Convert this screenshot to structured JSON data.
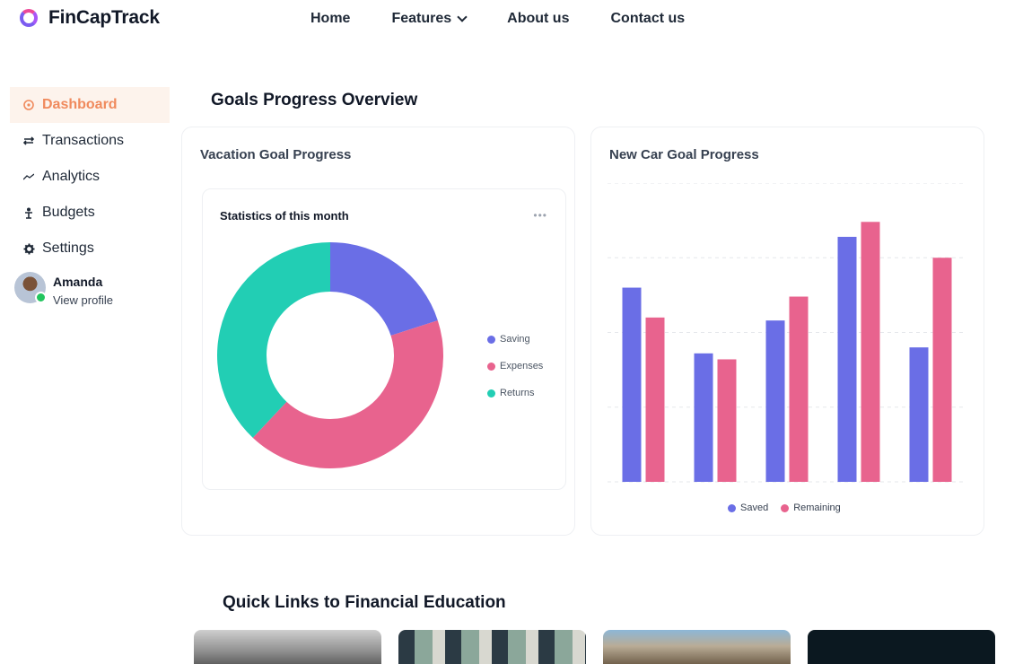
{
  "brand": {
    "name": "FinCapTrack"
  },
  "nav": {
    "items": [
      "Home",
      "Features",
      "About us",
      "Contact us"
    ]
  },
  "sidebar": {
    "items": [
      {
        "label": "Dashboard",
        "icon": "dashboard-icon"
      },
      {
        "label": "Transactions",
        "icon": "transactions-icon"
      },
      {
        "label": "Analytics",
        "icon": "analytics-icon"
      },
      {
        "label": "Budgets",
        "icon": "budgets-icon"
      },
      {
        "label": "Settings",
        "icon": "gear-icon"
      }
    ],
    "profile": {
      "name": "Amanda",
      "link": "View profile"
    }
  },
  "main": {
    "goals_title": "Goals Progress Overview",
    "vacation": {
      "title": "Vacation Goal Progress",
      "inner_title": "Statistics of this month"
    },
    "newcar": {
      "title": "New Car Goal Progress"
    },
    "education_title": "Quick Links to Financial Education"
  },
  "colors": {
    "accent": "#f08a5d",
    "saving": "#6a6ee6",
    "expenses": "#e8638e",
    "returns": "#22ceb4"
  },
  "chart_data": [
    {
      "type": "pie",
      "title": "Statistics of this month",
      "categories": [
        "Saving",
        "Expenses",
        "Returns"
      ],
      "values": [
        20,
        42,
        38
      ],
      "colors": [
        "#6a6ee6",
        "#e8638e",
        "#22ceb4"
      ],
      "legend": "right"
    },
    {
      "type": "bar",
      "categories": [
        "",
        "",
        "",
        "",
        ""
      ],
      "series": [
        {
          "name": "Saved",
          "values": [
            65,
            43,
            54,
            82,
            45
          ],
          "color": "#6a6ee6"
        },
        {
          "name": "Remaining",
          "values": [
            55,
            41,
            62,
            87,
            75
          ],
          "color": "#e8638e"
        }
      ],
      "ylim": [
        0,
        100
      ],
      "grid": true,
      "legend": "bottom"
    }
  ]
}
